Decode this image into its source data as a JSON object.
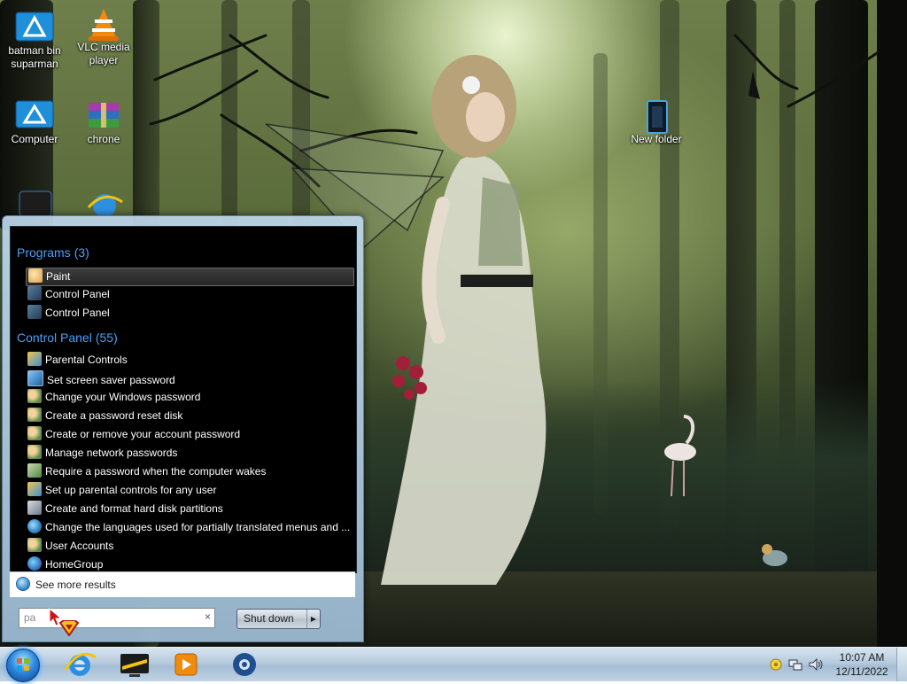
{
  "desktop": {
    "icons": [
      {
        "label_line1": "batman bin",
        "label_line2": "suparman"
      },
      {
        "label_line1": "VLC media",
        "label_line2": "player"
      },
      {
        "label_line1": "Computer"
      },
      {
        "label_line1": "chrone"
      },
      {
        "label_line1": "New folder"
      }
    ]
  },
  "start_menu": {
    "programs_header": {
      "label": "Programs",
      "count": "(3)"
    },
    "programs": [
      {
        "label": "Paint",
        "icon": "paint-palette-icon"
      },
      {
        "label": "Control Panel",
        "icon": "control-panel-icon"
      },
      {
        "label": "Control Panel",
        "icon": "control-panel-icon"
      }
    ],
    "control_panel_header": {
      "label": "Control Panel",
      "count": "(55)"
    },
    "control_panel_items": [
      {
        "label": "Parental Controls",
        "icon": "parental-controls-icon"
      },
      {
        "label": "Set screen saver password",
        "icon": "monitor-icon"
      },
      {
        "label": "Change your Windows password",
        "icon": "users-icon"
      },
      {
        "label": "Create a password reset disk",
        "icon": "users-icon"
      },
      {
        "label": "Create or remove your account password",
        "icon": "users-icon"
      },
      {
        "label": "Manage network passwords",
        "icon": "users-icon"
      },
      {
        "label": "Require a password when the computer wakes",
        "icon": "power-options-icon"
      },
      {
        "label": "Set up parental controls for any user",
        "icon": "parental-controls-icon"
      },
      {
        "label": "Create and format hard disk partitions",
        "icon": "admin-tools-icon"
      },
      {
        "label": "Change the languages used for partially translated menus and ...",
        "icon": "region-globe-icon"
      },
      {
        "label": "User Accounts",
        "icon": "users-icon"
      },
      {
        "label": "HomeGroup",
        "icon": "homegroup-icon"
      }
    ],
    "see_more": "See more results",
    "search": {
      "value": "pa"
    },
    "clear_icon": "×",
    "shutdown_label": "Shut down"
  },
  "taskbar": {
    "pinned": [
      "internet-explorer-icon",
      "media-center-icon",
      "media-player-icon",
      "steam-like-icon"
    ],
    "clock": {
      "time": "10:07 AM",
      "date": "12/11/2022"
    }
  },
  "colors": {
    "group_header": "#4e9ff2",
    "results_bg": "#000000"
  }
}
